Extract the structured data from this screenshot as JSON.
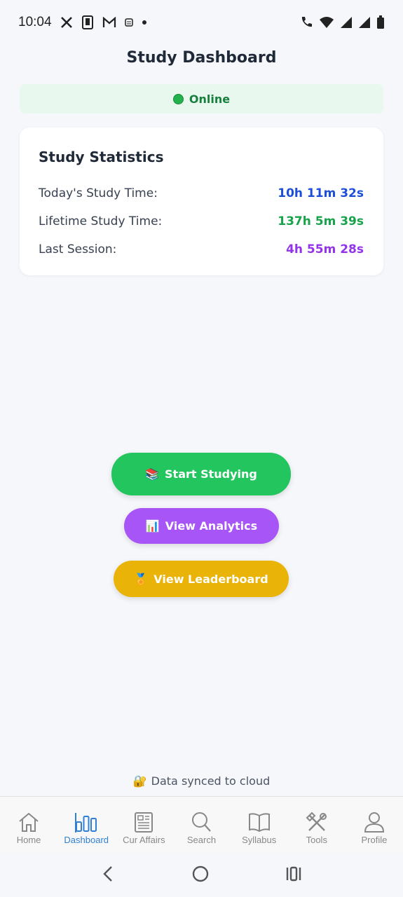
{
  "status_bar": {
    "time": "10:04",
    "left_icons": [
      "x-icon",
      "phone-icon",
      "gmail-icon",
      "notification-icon",
      "dot-icon"
    ],
    "right_icons": [
      "call-icon",
      "wifi-icon",
      "signal-icon",
      "signal-icon",
      "battery-icon"
    ]
  },
  "header": {
    "title": "Study Dashboard"
  },
  "status": {
    "label": "Online",
    "color": "#22b14c"
  },
  "stats": {
    "heading": "Study Statistics",
    "rows": [
      {
        "label": "Today's Study Time:",
        "value": "10h 11m 32s",
        "color": "#1d4ed8"
      },
      {
        "label": "Lifetime Study Time:",
        "value": "137h 5m 39s",
        "color": "#16a34a"
      },
      {
        "label": "Last Session:",
        "value": "4h 55m 28s",
        "color": "#9333ea"
      }
    ]
  },
  "actions": {
    "start_icon": "📚",
    "start_label": "Start Studying",
    "analytics_icon": "📊",
    "analytics_label": "View Analytics",
    "leaderboard_icon": "🏅",
    "leaderboard_label": "View Leaderboard"
  },
  "footer": {
    "sync_icon": "🔐",
    "sync_text": "Data synced to cloud"
  },
  "bottom_nav": [
    {
      "label": "Home",
      "icon": "home-icon",
      "active": false
    },
    {
      "label": "Dashboard",
      "icon": "bar-chart-icon",
      "active": true
    },
    {
      "label": "Cur Affairs",
      "icon": "newspaper-icon",
      "active": false
    },
    {
      "label": "Search",
      "icon": "search-icon",
      "active": false
    },
    {
      "label": "Syllabus",
      "icon": "book-icon",
      "active": false
    },
    {
      "label": "Tools",
      "icon": "tools-icon",
      "active": false
    },
    {
      "label": "Profile",
      "icon": "user-icon",
      "active": false
    }
  ],
  "colors": {
    "accent": "#2f7fd6",
    "green": "#22c55e",
    "purple": "#a855f7",
    "yellow": "#eab308"
  }
}
